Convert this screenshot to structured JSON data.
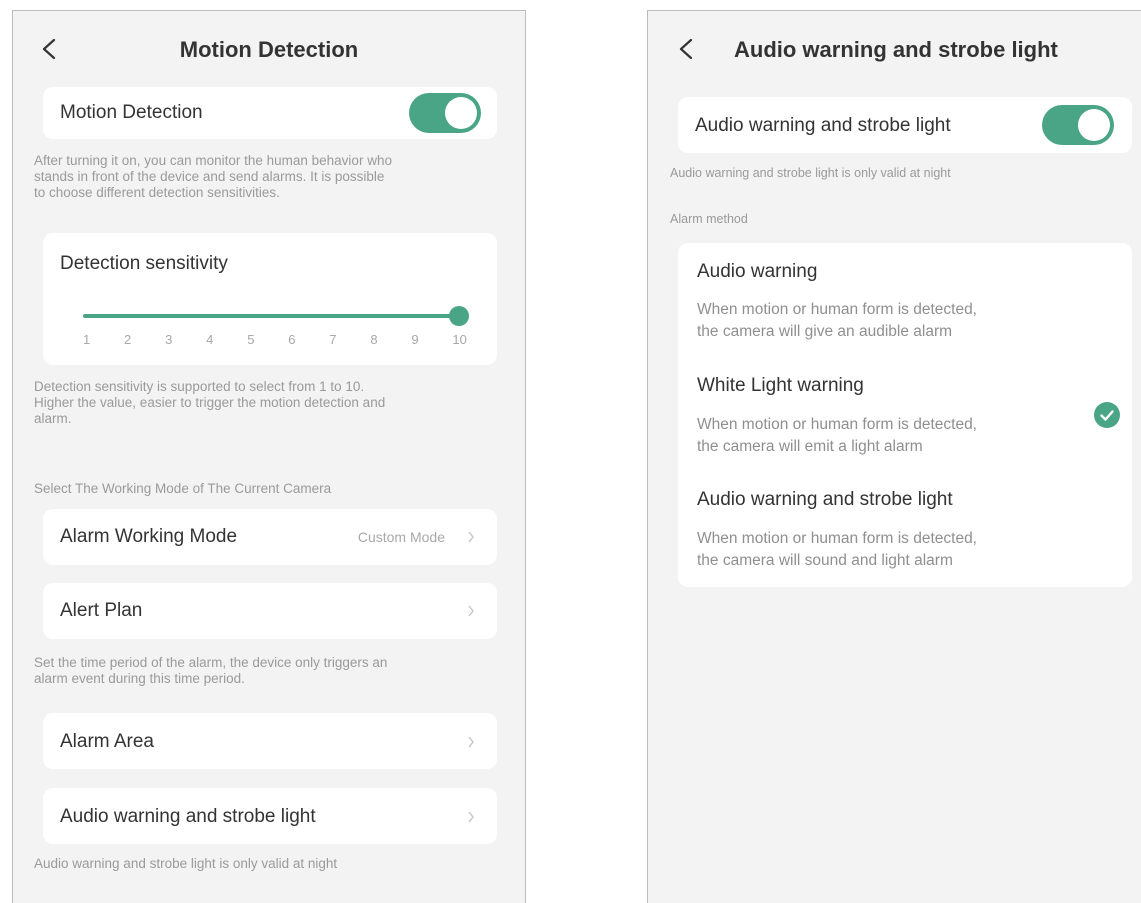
{
  "colors": {
    "accent": "#4aa587",
    "background": "#f3f3f3",
    "card": "#ffffff"
  },
  "left": {
    "title": "Motion Detection",
    "motion_detection": {
      "label": "Motion Detection",
      "enabled": true
    },
    "motion_note_lines": [
      "After turning it on, you can monitor the human behavior who",
      "stands in front of the device and send alarms. It is possible",
      "to choose different detection sensitivities."
    ],
    "sensitivity": {
      "label": "Detection sensitivity",
      "ticks": [
        "1",
        "2",
        "3",
        "4",
        "5",
        "6",
        "7",
        "8",
        "9",
        "10"
      ],
      "value": 10
    },
    "sensitivity_note_lines": [
      "Detection sensitivity is supported to select from 1 to 10.",
      "Higher the value, easier to trigger the motion detection and",
      "alarm."
    ],
    "working_mode_header": "Select The Working Mode of The Current Camera",
    "alarm_working_mode": {
      "label": "Alarm Working Mode",
      "value": "Custom Mode"
    },
    "alert_plan": {
      "label": "Alert Plan"
    },
    "alert_note_lines": [
      "Set the time period of the alarm, the device only triggers an",
      "alarm event during this time period."
    ],
    "alarm_area": {
      "label": "Alarm Area"
    },
    "audio_strobe": {
      "label": "Audio warning and strobe light"
    },
    "bottom_note": "Audio warning and strobe light is only valid at night"
  },
  "right": {
    "title": "Audio warning and strobe light",
    "toggle": {
      "label": "Audio warning and strobe light",
      "enabled": true
    },
    "night_note": "Audio warning and strobe light is only valid at night",
    "alarm_method_header": "Alarm method",
    "options": [
      {
        "title": "Audio warning",
        "desc_lines": [
          "When motion or human form is detected,",
          "the camera will give an audible alarm"
        ],
        "selected": false
      },
      {
        "title": "White Light warning",
        "desc_lines": [
          "When motion or human form is detected,",
          "the camera will emit a light alarm"
        ],
        "selected": true
      },
      {
        "title": "Audio warning and strobe light",
        "desc_lines": [
          "When motion or human form is detected,",
          "the camera will sound and light alarm"
        ],
        "selected": false
      }
    ]
  }
}
